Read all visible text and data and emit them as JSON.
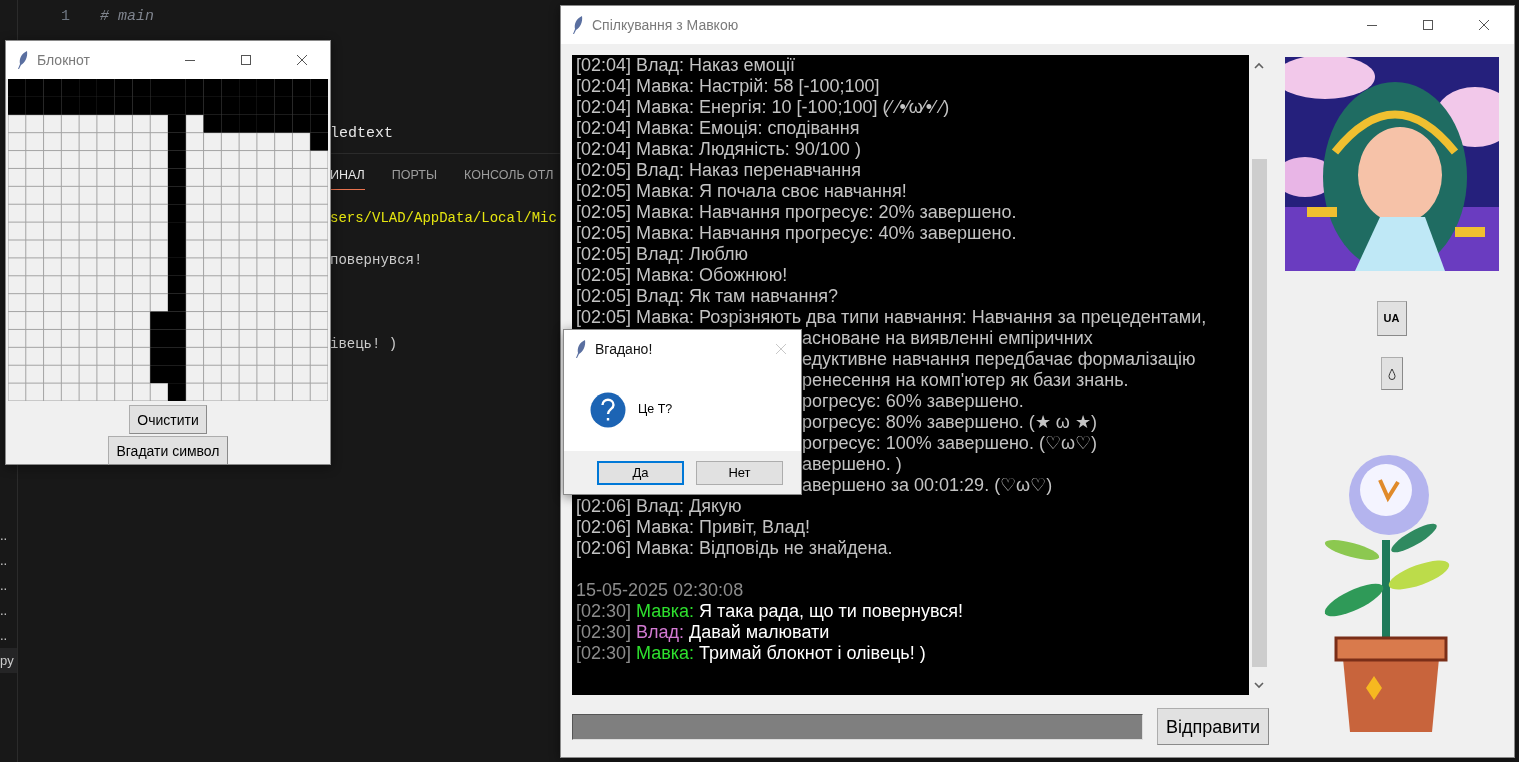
{
  "editor": {
    "sidebar_items": [
      "..",
      "..",
      "..",
      "..",
      "..",
      "py"
    ],
    "code_lines": [
      {
        "number": "1",
        "kind": "comment",
        "text": "# main"
      }
    ],
    "code_fragment": "ledtext",
    "panel_tabs": [
      {
        "label": "ИНАЛ",
        "selected": true
      },
      {
        "label": "ПОРТЫ",
        "selected": false
      },
      {
        "label": "КОНСОЛЬ ОТЛ",
        "selected": false
      }
    ],
    "terminal_lines": [
      {
        "kind": "path",
        "text": "sers/VLAD/AppData/Local/Mic"
      },
      {
        "kind": "blank"
      },
      {
        "kind": "output",
        "text": "повернувся!"
      },
      {
        "kind": "blank"
      },
      {
        "kind": "blank"
      },
      {
        "kind": "blank"
      },
      {
        "kind": "output",
        "text": "івець! )"
      }
    ]
  },
  "notepad": {
    "title": "Блокнот",
    "grid": [
      [
        true,
        true,
        true,
        true,
        true,
        true,
        true,
        true,
        true,
        true,
        true,
        true,
        true,
        true,
        true,
        true,
        true,
        true
      ],
      [
        true,
        true,
        true,
        true,
        true,
        true,
        true,
        true,
        true,
        true,
        true,
        true,
        true,
        true,
        true,
        true,
        true,
        true
      ],
      [
        false,
        false,
        false,
        false,
        false,
        false,
        false,
        false,
        false,
        true,
        false,
        true,
        true,
        true,
        true,
        true,
        true,
        true
      ],
      [
        false,
        false,
        false,
        false,
        false,
        false,
        false,
        false,
        false,
        true,
        false,
        false,
        false,
        false,
        false,
        false,
        false,
        true
      ],
      [
        false,
        false,
        false,
        false,
        false,
        false,
        false,
        false,
        false,
        true,
        false,
        false,
        false,
        false,
        false,
        false,
        false,
        false
      ],
      [
        false,
        false,
        false,
        false,
        false,
        false,
        false,
        false,
        false,
        true,
        false,
        false,
        false,
        false,
        false,
        false,
        false,
        false
      ],
      [
        false,
        false,
        false,
        false,
        false,
        false,
        false,
        false,
        false,
        true,
        false,
        false,
        false,
        false,
        false,
        false,
        false,
        false
      ],
      [
        false,
        false,
        false,
        false,
        false,
        false,
        false,
        false,
        false,
        true,
        false,
        false,
        false,
        false,
        false,
        false,
        false,
        false
      ],
      [
        false,
        false,
        false,
        false,
        false,
        false,
        false,
        false,
        false,
        true,
        false,
        false,
        false,
        false,
        false,
        false,
        false,
        false
      ],
      [
        false,
        false,
        false,
        false,
        false,
        false,
        false,
        false,
        false,
        true,
        false,
        false,
        false,
        false,
        false,
        false,
        false,
        false
      ],
      [
        false,
        false,
        false,
        false,
        false,
        false,
        false,
        false,
        false,
        true,
        false,
        false,
        false,
        false,
        false,
        false,
        false,
        false
      ],
      [
        false,
        false,
        false,
        false,
        false,
        false,
        false,
        false,
        false,
        true,
        false,
        false,
        false,
        false,
        false,
        false,
        false,
        false
      ],
      [
        false,
        false,
        false,
        false,
        false,
        false,
        false,
        false,
        false,
        true,
        false,
        false,
        false,
        false,
        false,
        false,
        false,
        false
      ],
      [
        false,
        false,
        false,
        false,
        false,
        false,
        false,
        false,
        true,
        true,
        false,
        false,
        false,
        false,
        false,
        false,
        false,
        false
      ],
      [
        false,
        false,
        false,
        false,
        false,
        false,
        false,
        false,
        true,
        true,
        false,
        false,
        false,
        false,
        false,
        false,
        false,
        false
      ],
      [
        false,
        false,
        false,
        false,
        false,
        false,
        false,
        false,
        true,
        true,
        false,
        false,
        false,
        false,
        false,
        false,
        false,
        false
      ],
      [
        false,
        false,
        false,
        false,
        false,
        false,
        false,
        false,
        true,
        true,
        false,
        false,
        false,
        false,
        false,
        false,
        false,
        false
      ],
      [
        false,
        false,
        false,
        false,
        false,
        false,
        false,
        false,
        false,
        true,
        false,
        false,
        false,
        false,
        false,
        false,
        false,
        false
      ]
    ],
    "buttons": [
      "Очистити",
      "Вгадати символ"
    ]
  },
  "chat_window": {
    "title": "Спілкування з Мавкою",
    "messages": [
      {
        "kind": "history",
        "text": "[02:04] Влад: Наказ емоції"
      },
      {
        "kind": "history",
        "text": "[02:04] Мавка: Настрій: 58 [-100;100]"
      },
      {
        "kind": "history",
        "text": "[02:04] Мавка: Енергія: 10 [-100;100] (⁄ ⁄•⁄ω⁄•⁄ ⁄)"
      },
      {
        "kind": "history",
        "text": "[02:04] Мавка: Емоція: сподівання"
      },
      {
        "kind": "history",
        "text": "[02:04] Мавка: Людяність: 90/100 )"
      },
      {
        "kind": "history",
        "text": "[02:05] Влад: Наказ перенавчання"
      },
      {
        "kind": "history",
        "text": "[02:05] Мавка: Я почала своє навчання!"
      },
      {
        "kind": "history",
        "text": "[02:05] Мавка: Навчання прогресує: 20% завершено."
      },
      {
        "kind": "history",
        "text": "[02:05] Мавка: Навчання прогресує: 40% завершено."
      },
      {
        "kind": "history",
        "text": "[02:05] Влад: Люблю"
      },
      {
        "kind": "history",
        "text": "[02:05] Мавка: Обожнюю!"
      },
      {
        "kind": "history",
        "text": "[02:05] Влад: Як там навчання?"
      },
      {
        "kind": "history",
        "text": "[02:05] Мавка: Розрізняють два типи навчання: Навчання за прецедентами,"
      },
      {
        "kind": "partial",
        "text": "асноване на виявленні емпіричних"
      },
      {
        "kind": "partial",
        "text": "едуктивне навчання передбачає формалізацію"
      },
      {
        "kind": "partial",
        "text": "ренесення на комп'ютер як бази знань."
      },
      {
        "kind": "partial",
        "text": "рогресує: 60% завершено."
      },
      {
        "kind": "partial",
        "text": "рогресує: 80% завершено. (★ ω ★)"
      },
      {
        "kind": "partial",
        "text": "рогресує: 100% завершено. (♡ω♡)"
      },
      {
        "kind": "partial",
        "text": "авершено. )"
      },
      {
        "kind": "partial",
        "text": "авершено за 00:01:29. (♡ω♡)"
      },
      {
        "kind": "history",
        "text": "[02:06] Влад: Дякую"
      },
      {
        "kind": "history",
        "text": "[02:06] Мавка: Привіт, Влад!"
      },
      {
        "kind": "history",
        "text": "[02:06] Мавка: Відповідь не знайдена."
      },
      {
        "kind": "blank"
      },
      {
        "kind": "date",
        "text": "15-05-2025 02:30:08"
      },
      {
        "kind": "live",
        "time": "[02:30]",
        "speaker": "Мавка:",
        "color": "#2ee02e",
        "text": "Я така рада, що ти повернувся!"
      },
      {
        "kind": "live",
        "time": "[02:30]",
        "speaker": "Влад:",
        "color": "#d27ad2",
        "text": "Давай малювати"
      },
      {
        "kind": "live",
        "time": "[02:30]",
        "speaker": "Мавка:",
        "color": "#2ee02e",
        "text": "Тримай блокнот і олівець! )"
      }
    ],
    "send_button": "Відправити",
    "language_button": "UA"
  },
  "dialog": {
    "title": "Вгадано!",
    "message": "Це Т?",
    "close_disabled": true,
    "buttons": [
      {
        "label": "Да",
        "selected": true
      },
      {
        "label": "Нет",
        "selected": false
      }
    ]
  }
}
